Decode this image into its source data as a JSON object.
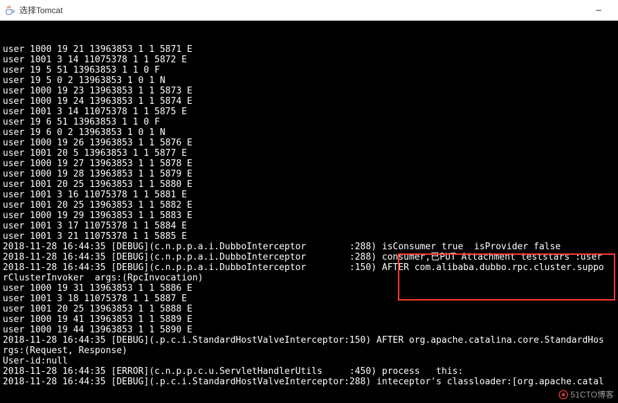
{
  "window": {
    "title": "选择Tomcat",
    "icon_name": "java-cup-icon"
  },
  "console_lines": [
    "user 1000 19 21 13963853 1 1 5871 E",
    "user 1001 3 14 11075378 1 1 5872 E",
    "user 19 5 51 13963853 1 1 0 F",
    "user 19 5 0 2 13963853 1 0 1 N",
    "user 1000 19 23 13963853 1 1 5873 E",
    "user 1000 19 24 13963853 1 1 5874 E",
    "user 1001 3 14 11075378 1 1 5875 E",
    "user 19 6 51 13963853 1 1 0 F",
    "user 19 6 0 2 13963853 1 0 1 N",
    "user 1000 19 26 13963853 1 1 5876 E",
    "user 1001 20 5 13963853 1 1 5877 E",
    "user 1000 19 27 13963853 1 1 5878 E",
    "user 1000 19 28 13963853 1 1 5879 E",
    "user 1001 20 25 13963853 1 1 5880 E",
    "user 1001 3 16 11075378 1 1 5881 E",
    "user 1001 20 25 13963853 1 1 5882 E",
    "user 1000 19 29 13963853 1 1 5883 E",
    "user 1001 3 17 11075378 1 1 5884 E",
    "user 1001 3 21 11075378 1 1 5885 E",
    "2018-11-28 16:44:35 [DEBUG](c.n.p.p.a.i.DubboInterceptor        :288) isConsumer true  isProvider false",
    "2018-11-28 16:44:35 [DEBUG](c.n.p.p.a.i.DubboInterceptor        :288) consumer,已PUT Attachment teststars :user",
    "2018-11-28 16:44:35 [DEBUG](c.n.p.p.a.i.DubboInterceptor        :150) AFTER com.alibaba.dubbo.rpc.cluster.suppo",
    "rClusterInvoker  args:(RpcInvocation)",
    "user 1000 19 31 13963853 1 1 5886 E",
    "user 1001 3 18 11075378 1 1 5887 E",
    "user 1001 20 25 13963853 1 1 5888 E",
    "user 1000 19 41 13963853 1 1 5889 E",
    "user 1000 19 44 13963853 1 1 5890 E",
    "2018-11-28 16:44:35 [DEBUG](.p.c.i.StandardHostValveInterceptor:150) AFTER org.apache.catalina.core.StandardHos",
    "rgs:(Request, Response)",
    "User-id:null",
    "2018-11-28 16:44:35 [ERROR](c.n.p.p.c.u.ServletHandlerUtils     :450) process   this:",
    "2018-11-28 16:44:35 [DEBUG](.p.c.i.StandardHostValveInterceptor:288) inteceptor's classloader:[org.apache.catal"
  ],
  "watermark": "51CTO博客"
}
